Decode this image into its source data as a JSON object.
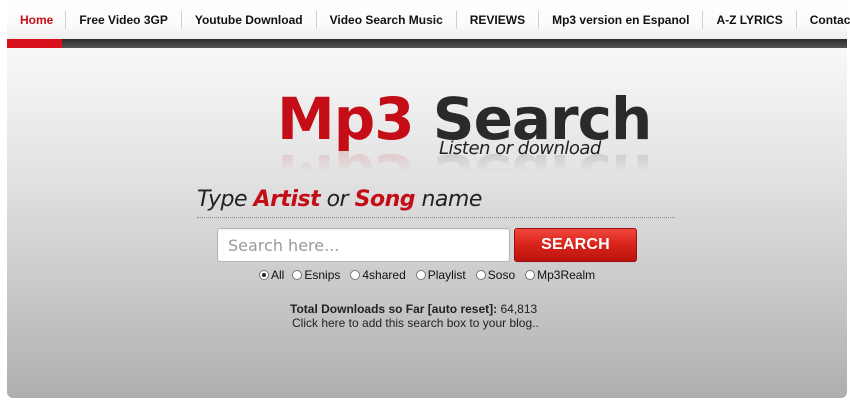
{
  "nav": {
    "items": [
      {
        "label": "Home"
      },
      {
        "label": "Free Video 3GP"
      },
      {
        "label": "Youtube Download"
      },
      {
        "label": "Video Search Music"
      },
      {
        "label": "REVIEWS"
      },
      {
        "label": "Mp3 version en Espanol"
      },
      {
        "label": "A-Z LYRICS"
      },
      {
        "label": "Contacts"
      }
    ],
    "active_color": "#c40d16"
  },
  "logo": {
    "mp3": "Mp3",
    "search": "Search",
    "tagline": "Listen or download"
  },
  "headline": {
    "part1": "Type",
    "artist": "Artist",
    "part2": "or",
    "song": "Song",
    "part3": "name"
  },
  "search": {
    "placeholder": "Search here...",
    "value": "",
    "button_label": "SEARCH"
  },
  "sources": {
    "selected": "All",
    "options": [
      "All",
      "Esnips",
      "4shared",
      "Playlist",
      "Soso",
      "Mp3Realm"
    ]
  },
  "stats": {
    "label": "Total Downloads so Far [auto reset]:",
    "value": "64,813",
    "blog_link": "Click here to add this search box to your blog.."
  },
  "colors": {
    "accent_red": "#c40d16",
    "button_red": "#d8231b",
    "nav_dark": "#2c2c2c"
  }
}
